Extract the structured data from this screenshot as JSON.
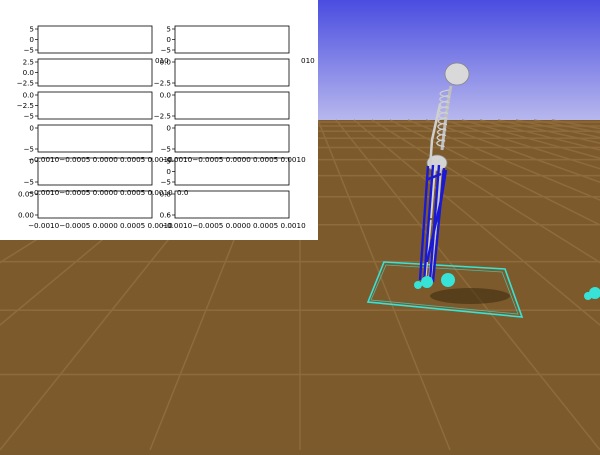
{
  "scene": {
    "sky_colors": [
      "#4a4de0",
      "#b9b9ee"
    ],
    "ground_color": "#7d5a2c",
    "grid_color": "#93703f",
    "skeleton_color": "#d9d9d9",
    "muscle_color": "#1a1ad6",
    "marker_color": "#37e3d6",
    "support_polygon_color": "#37e3d6"
  },
  "plots": {
    "background": "#ffffff",
    "subplots": [
      {
        "ticks": [
          "5",
          "0",
          "−5"
        ]
      },
      {
        "ticks": [
          "5",
          "0",
          "−5"
        ]
      },
      {
        "ticks": [
          "2.5",
          "0.0",
          "−2.5"
        ]
      },
      {
        "ticks": [
          "0.0",
          "−2.5"
        ]
      },
      {
        "ticks": [
          "0.0",
          "−2.5",
          "−5"
        ]
      },
      {
        "ticks": [
          "0.0",
          "−2.5"
        ]
      },
      {
        "ticks": [
          "0",
          "−5"
        ]
      },
      {
        "ticks": [
          "0",
          "−5"
        ]
      },
      {
        "ticks": [
          "0",
          "−5"
        ]
      },
      {
        "ticks": [
          "5",
          "0",
          "−5"
        ]
      },
      {
        "ticks": [
          "0.05",
          "0.00"
        ]
      },
      {
        "ticks": [
          "0.8",
          "0.6"
        ]
      }
    ],
    "xtick_text_left": "−0.0010−0.0005 0.0000 0.0005 0.0010",
    "xtick_text_right": "−0.0010−0.0005 0.0000 0.0005 0.0010",
    "xtick_fragment_right": "010",
    "xtick_fragment_mid": "010",
    "xtick_fragment_mid2": "0.0"
  }
}
